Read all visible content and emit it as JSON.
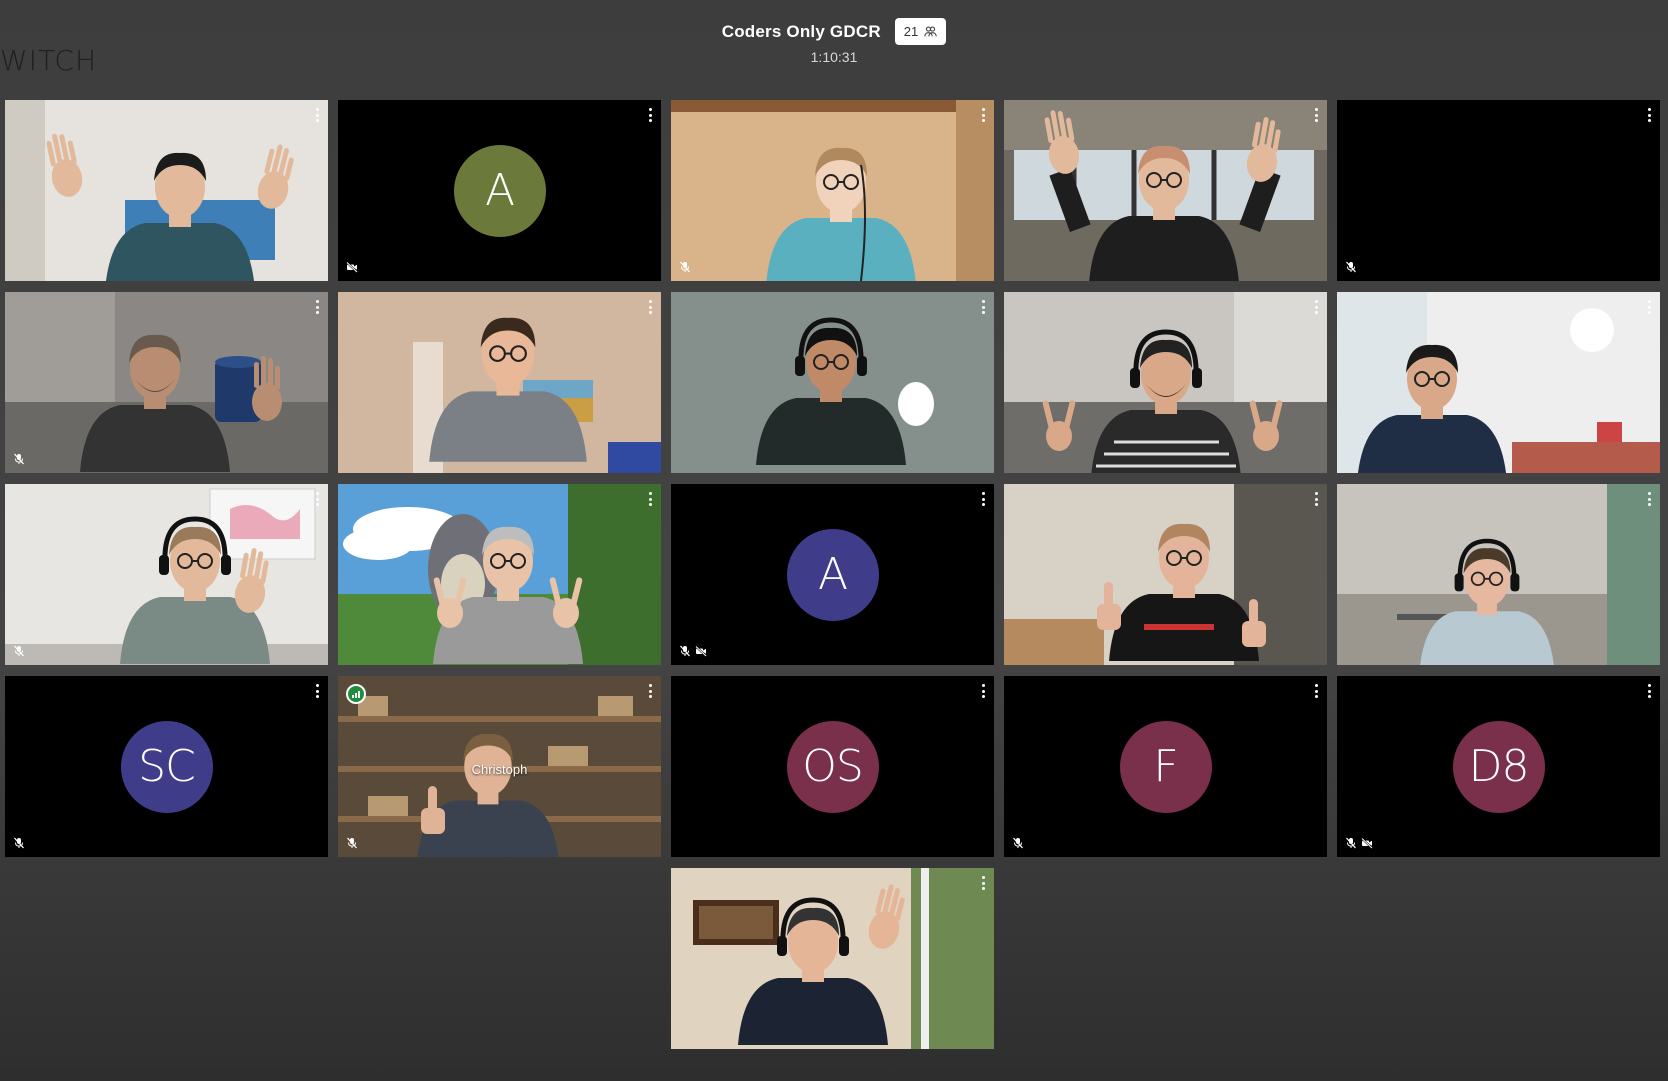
{
  "app": {
    "logo_text": "WITCH"
  },
  "meeting": {
    "title": "Coders Only GDCR",
    "participant_count": "21",
    "duration": "1:10:31"
  },
  "colors": {
    "avatar_olive": "#6b7a3a",
    "avatar_indigo": "#3f3d8a",
    "avatar_maroon": "#7a2f4a",
    "speaking_green": "#1e8e3e"
  },
  "tiles": [
    {
      "type": "video",
      "scene": "waving-man-blue-sofa",
      "muted": false,
      "camera_off": false
    },
    {
      "type": "avatar",
      "initials": "A",
      "avatar_color": "olive",
      "muted": false,
      "camera_off": true
    },
    {
      "type": "video",
      "scene": "woman-with-headset",
      "muted": true,
      "camera_off": false
    },
    {
      "type": "video",
      "scene": "man-arms-raised-office",
      "muted": false,
      "camera_off": false
    },
    {
      "type": "blank",
      "muted": true,
      "camera_off": false
    },
    {
      "type": "video",
      "scene": "man-with-mug",
      "muted": true,
      "camera_off": false
    },
    {
      "type": "video",
      "scene": "smiling-man-grey-shirt",
      "muted": false,
      "camera_off": false
    },
    {
      "type": "video",
      "scene": "man-with-headphones",
      "muted": false,
      "camera_off": false
    },
    {
      "type": "video",
      "scene": "man-peace-signs",
      "muted": false,
      "camera_off": false
    },
    {
      "type": "video",
      "scene": "man-side-view-bright-room",
      "muted": false,
      "camera_off": false
    },
    {
      "type": "video",
      "scene": "man-with-map",
      "muted": true,
      "camera_off": false
    },
    {
      "type": "video",
      "scene": "man-totoro-background",
      "muted": false,
      "camera_off": false
    },
    {
      "type": "avatar",
      "initials": "A",
      "avatar_color": "indigo",
      "muted": true,
      "camera_off": true
    },
    {
      "type": "video",
      "scene": "man-thumbs-up-kitchen",
      "muted": false,
      "camera_off": false
    },
    {
      "type": "video",
      "scene": "man-headset-kitchen",
      "muted": false,
      "camera_off": false
    },
    {
      "type": "avatar",
      "initials": "SC",
      "avatar_color": "indigo",
      "muted": true,
      "camera_off": false
    },
    {
      "type": "video",
      "scene": "christoph-thumbs-up",
      "name": "Christoph",
      "speaking": true,
      "muted": true,
      "camera_off": false
    },
    {
      "type": "avatar",
      "initials": "OS",
      "avatar_color": "maroon",
      "muted": false,
      "camera_off": false
    },
    {
      "type": "avatar",
      "initials": "F",
      "avatar_color": "maroon",
      "muted": true,
      "camera_off": false
    },
    {
      "type": "avatar",
      "initials": "D8",
      "avatar_color": "maroon",
      "muted": true,
      "camera_off": true
    },
    {
      "type": "video",
      "scene": "man-waving-window",
      "muted": false,
      "camera_off": false
    }
  ]
}
